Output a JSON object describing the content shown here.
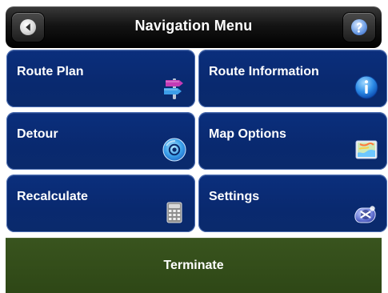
{
  "header": {
    "title": "Navigation Menu",
    "back_icon": "back-arrow-icon",
    "help_icon": "help-icon"
  },
  "menu": {
    "items": [
      {
        "label": "Route Plan",
        "icon": "signpost-icon"
      },
      {
        "label": "Route Information",
        "icon": "info-icon"
      },
      {
        "label": "Detour",
        "icon": "cd-disc-icon"
      },
      {
        "label": "Map Options",
        "icon": "map-icon"
      },
      {
        "label": "Recalculate",
        "icon": "calculator-icon"
      },
      {
        "label": "Settings",
        "icon": "settings-badge-icon"
      }
    ]
  },
  "footer": {
    "label": "Terminate"
  },
  "colors": {
    "tile_bg": "#0b2f7d",
    "tile_border": "#4d6fb4",
    "header_bg": "#141414",
    "footer_bg": "#35501a",
    "text": "#ffffff"
  }
}
